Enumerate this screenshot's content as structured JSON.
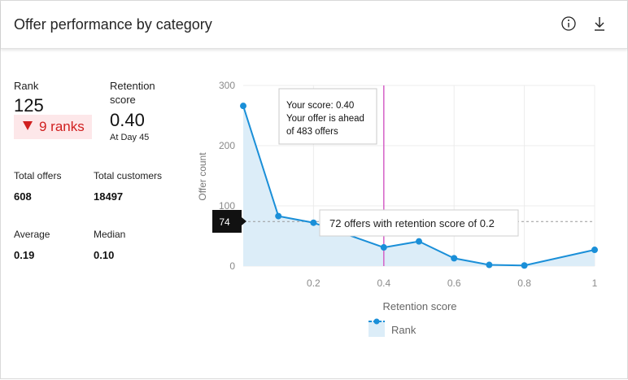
{
  "header": {
    "title": "Offer performance by category",
    "info_icon": "info-icon",
    "download_icon": "download-icon"
  },
  "stats": {
    "rank_label": "Rank",
    "rank_value": "125",
    "rank_change": "9 ranks",
    "rank_change_direction": "down",
    "retention_label_1": "Retention",
    "retention_label_2": "score",
    "retention_value": "0.40",
    "retention_day": "At Day 45",
    "total_offers_label": "Total offers",
    "total_offers_value": "608",
    "total_customers_label": "Total customers",
    "total_customers_value": "18497",
    "average_label": "Average",
    "average_value": "0.19",
    "median_label": "Median",
    "median_value": "0.10"
  },
  "colors": {
    "series_line": "#1a8fd8",
    "series_fill": "#dcedf8",
    "marker_line": "#d462c8",
    "negative": "#d01f1f",
    "badge_bg": "#fde7e9"
  },
  "chart_data": {
    "type": "area",
    "xlabel": "Retention score",
    "ylabel": "Offer count",
    "xlim": [
      0,
      1
    ],
    "ylim": [
      0,
      300
    ],
    "x_ticks": [
      "0.2",
      "0.4",
      "0.6",
      "0.8",
      "1"
    ],
    "y_ticks": [
      "0",
      "100",
      "200",
      "300"
    ],
    "grid": true,
    "legend": "bottom-center",
    "series": [
      {
        "name": "Rank",
        "x": [
          0,
          0.1,
          0.2,
          0.4,
          0.5,
          0.6,
          0.7,
          0.8,
          1.0
        ],
        "y": [
          266,
          83,
          72,
          31,
          41,
          13,
          2,
          1,
          27
        ]
      }
    ],
    "vertical_marker": {
      "x": 0.4
    },
    "reference_line": {
      "y": 74,
      "label": "74"
    },
    "annotation_score": {
      "line1": "Your score: 0.40",
      "line2": "Your offer is ahead",
      "line3": "of 483 offers"
    },
    "tooltip": {
      "x": 0.2,
      "text": "72 offers with retention score of 0.2"
    }
  }
}
